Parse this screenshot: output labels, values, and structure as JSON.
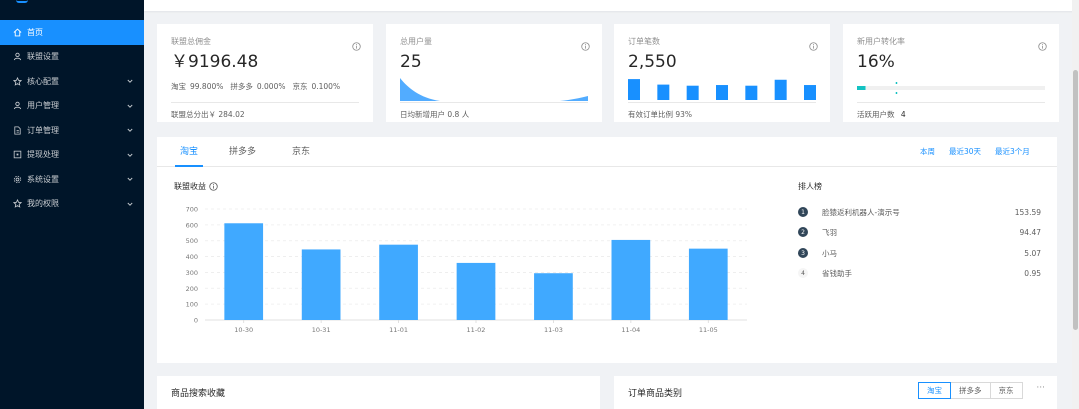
{
  "sidebar": {
    "items": [
      {
        "label": "首页",
        "icon": "home-icon",
        "active": true,
        "has_arrow": false
      },
      {
        "label": "联盟设置",
        "icon": "user-icon",
        "active": false,
        "has_arrow": false
      },
      {
        "label": "核心配置",
        "icon": "star-icon",
        "active": false,
        "has_arrow": true
      },
      {
        "label": "用户管理",
        "icon": "user-icon",
        "active": false,
        "has_arrow": true
      },
      {
        "label": "订单管理",
        "icon": "file-icon",
        "active": false,
        "has_arrow": true
      },
      {
        "label": "提现处理",
        "icon": "wallet-icon",
        "active": false,
        "has_arrow": true
      },
      {
        "label": "系统设置",
        "icon": "gear-icon",
        "active": false,
        "has_arrow": true
      },
      {
        "label": "我的权限",
        "icon": "star-icon",
        "active": false,
        "has_arrow": true
      }
    ]
  },
  "stats": {
    "commission": {
      "title": "联盟总佣金",
      "value": "￥9196.48",
      "split": [
        {
          "name": "淘宝",
          "pct": "99.800%"
        },
        {
          "name": "拼多多",
          "pct": "0.000%"
        },
        {
          "name": "京东",
          "pct": "0.100%"
        }
      ],
      "footer": "联盟总分出￥ 284.02"
    },
    "users": {
      "title": "总用户量",
      "value": "25",
      "footer": "日均新增用户 0.8 人"
    },
    "orders": {
      "title": "订单笔数",
      "value": "2,550",
      "footer": "有效订单比例 93%",
      "bars": [
        0.95,
        0.7,
        0.65,
        0.68,
        0.65,
        0.92,
        0.68
      ]
    },
    "conversion": {
      "title": "新用户转化率",
      "value": "16%",
      "progress": 0.16,
      "target": 0.21,
      "footer_label": "活跃用户数",
      "footer_value": "4"
    }
  },
  "main": {
    "tabs": [
      "淘宝",
      "拼多多",
      "京东"
    ],
    "active_tab": 0,
    "ranges": [
      "本周",
      "最近30天",
      "最近3个月"
    ],
    "chart_title": "联盟收益",
    "ranking_title": "排人榜",
    "ranking": [
      {
        "rank": "1",
        "name": "脸猿返利机器人-演示号",
        "value": "153.59"
      },
      {
        "rank": "2",
        "name": "飞羽",
        "value": "94.47"
      },
      {
        "rank": "3",
        "name": "小马",
        "value": "5.07"
      },
      {
        "rank": "4",
        "name": "省钱助手",
        "value": "0.95"
      }
    ]
  },
  "chart_data": {
    "type": "bar",
    "title": "联盟收益",
    "categories": [
      "10-30",
      "10-31",
      "11-01",
      "11-02",
      "11-03",
      "11-04",
      "11-05"
    ],
    "values": [
      610,
      445,
      475,
      360,
      295,
      505,
      450
    ],
    "ylim": [
      0,
      700
    ],
    "yticks": [
      0,
      100,
      200,
      300,
      400,
      500,
      600,
      700
    ],
    "grid": true,
    "color": "#40a9ff"
  },
  "bottom": {
    "search_title": "商品搜索收藏",
    "category_title": "订单商品类别",
    "segments": [
      "淘宝",
      "拼多多",
      "京东"
    ],
    "active_segment": 0,
    "more": "···"
  },
  "colors": {
    "sidebar_bg": "#001529",
    "primary": "#1890ff",
    "bar": "#40a9ff",
    "area": "#1890ff",
    "progress_track": "#f0f0f0",
    "progress_fill": "#13c2c2"
  }
}
